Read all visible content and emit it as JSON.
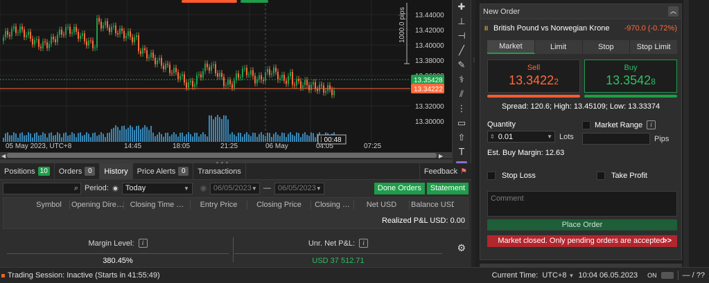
{
  "chart": {
    "price_labels": [
      "13.44000",
      "13.42000",
      "13.40000",
      "13.38000",
      "13.36000",
      "13.32000",
      "13.30000"
    ],
    "bid_badge": "13.3542",
    "bid_badge_small": "8",
    "ask_badge": "13.3422",
    "ask_badge_small": "2",
    "time_labels": [
      "05 May 2023, UTC+8",
      "14:45",
      "18:05",
      "21:25",
      "06 May",
      "04:05",
      "07:25"
    ],
    "countdown": "00:48",
    "pips_label": "1000.0 pips",
    "colors": {
      "up": "#1e9e4a",
      "down": "#ff6a3d",
      "bg": "#161616",
      "volume": "#3a88b8"
    }
  },
  "tabs": [
    {
      "label": "Positions",
      "count": "10",
      "count_style": "green",
      "active": false
    },
    {
      "label": "Orders",
      "count": "0",
      "count_style": "grey",
      "active": false
    },
    {
      "label": "History",
      "count": "",
      "count_style": "",
      "active": true
    },
    {
      "label": "Price Alerts",
      "count": "0",
      "count_style": "grey",
      "active": false
    },
    {
      "label": "Transactions",
      "count": "",
      "count_style": "",
      "active": false
    }
  ],
  "feedback_label": "Feedback",
  "filters": {
    "period_label": "Period:",
    "period_value": "Today",
    "date_from": "06/05/2023",
    "date_to": "06/05/2023",
    "done_orders": "Done Orders",
    "statement": "Statement"
  },
  "history_columns": [
    "Symbol",
    "Opening Dire…",
    "Closing Time …",
    "Entry Price",
    "Closing Price",
    "Closing …",
    "Net USD",
    "Balance USD"
  ],
  "realized_pl": "Realized P&L USD:  0.00",
  "summary": {
    "margin_level_label": "Margin Level:",
    "margin_level_value": "380.45%",
    "unr_label": "Unr. Net P&L:",
    "unr_value": "USD 37 512.71"
  },
  "order": {
    "title": "New Order",
    "symbol": "British Pound vs Norwegian Krone",
    "change": "-970.0 (-0.72%)",
    "order_tabs": [
      "Market",
      "Limit",
      "Stop",
      "Stop Limit"
    ],
    "sell_label": "Sell",
    "sell_price": "13.3422",
    "sell_price_small": "2",
    "buy_label": "Buy",
    "buy_price": "13.3542",
    "buy_price_small": "8",
    "spread_text": "Spread: 120.6; High: 13.45109; Low: 13.33374",
    "quantity_label": "Quantity",
    "quantity_value": "0.01",
    "lots_label": "Lots",
    "market_range_label": "Market Range",
    "pips_label": "Pips",
    "margin_text": "Est. Buy Margin: 12.63",
    "stop_loss_label": "Stop Loss",
    "take_profit_label": "Take Profit",
    "comment_placeholder": "Comment",
    "place_order": "Place Order",
    "market_closed": "Market closed. Only pending orders are accepted.",
    "arrows": ">>"
  },
  "status": {
    "session": "Trading Session: Inactive (Starts in 41:55:49)",
    "current_time_label": "Current Time:",
    "timezone": "UTC+8",
    "datetime": "10:04 06.05.2023",
    "on_label": "ON",
    "counter": "— / ??"
  },
  "icons": [
    "search-icon",
    "info-icon",
    "gear-icon",
    "chevron-up-icon",
    "pause-icon",
    "feedback-icon",
    "crosshair-icon",
    "line-icon",
    "text-icon"
  ]
}
